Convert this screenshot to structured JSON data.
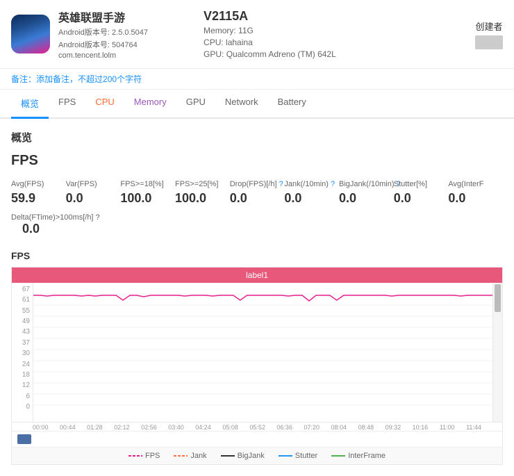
{
  "header": {
    "app_name": "英雄联盟手游",
    "android_version": "Android版本号: 2.5.0.5047",
    "android_build": "Android版本号: 504764",
    "package": "com.tencent.lolm",
    "device_model": "V2115A",
    "memory": "Memory: 11G",
    "cpu": "CPU: lahaina",
    "gpu": "GPU: Qualcomm Adreno (TM) 642L",
    "creator_label": "创建者"
  },
  "note": {
    "prefix": "备注：",
    "link_text": "添加备注，不超过200个字符"
  },
  "tabs": [
    {
      "id": "overview",
      "label": "概览",
      "active": true
    },
    {
      "id": "fps",
      "label": "FPS",
      "active": false
    },
    {
      "id": "cpu",
      "label": "CPU",
      "active": false,
      "color": "cpu"
    },
    {
      "id": "memory",
      "label": "Memory",
      "active": false,
      "color": "memory"
    },
    {
      "id": "gpu",
      "label": "GPU",
      "active": false
    },
    {
      "id": "network",
      "label": "Network",
      "active": false
    },
    {
      "id": "battery",
      "label": "Battery",
      "active": false
    }
  ],
  "page_title": "概览",
  "fps_section": {
    "title": "FPS",
    "metrics": [
      {
        "label": "Avg(FPS)",
        "value": "59.9"
      },
      {
        "label": "Var(FPS)",
        "value": "0.0"
      },
      {
        "label": "FPS>=18[%]",
        "value": "100.0"
      },
      {
        "label": "FPS>=25[%]",
        "value": "100.0"
      },
      {
        "label": "Drop(FPS)[/h]",
        "value": "0.0",
        "has_help": true
      },
      {
        "label": "Jank(/10min)",
        "value": "0.0",
        "has_help": true
      },
      {
        "label": "BigJank(/10min)",
        "value": "0.0",
        "has_help": true
      },
      {
        "label": "Stutter[%]",
        "value": "0.0"
      },
      {
        "label": "Avg(InterF",
        "value": "0.0"
      }
    ],
    "delta_label": "Delta(FTime)>100ms[/h]",
    "delta_has_help": true,
    "delta_value": "0.0"
  },
  "chart": {
    "title": "FPS",
    "label_bar": "label1",
    "y_labels": [
      "67",
      "61",
      "55",
      "49",
      "43",
      "37",
      "30",
      "24",
      "18",
      "12",
      "6",
      "0"
    ],
    "x_labels": [
      "00:00",
      "00:44",
      "01:28",
      "02:12",
      "02:56",
      "03:40",
      "04:24",
      "05:08",
      "05:52",
      "06:36",
      "07:20",
      "08:04",
      "08:48",
      "09:32",
      "10:16",
      "11:00",
      "11:44"
    ]
  },
  "legend": [
    {
      "label": "FPS",
      "color": "#e91e8c",
      "style": "dashed"
    },
    {
      "label": "Jank",
      "color": "#ff7043",
      "style": "dashed"
    },
    {
      "label": "BigJank",
      "color": "#333",
      "style": "solid"
    },
    {
      "label": "Stutter",
      "color": "#2196f3",
      "style": "solid"
    },
    {
      "label": "InterFrame",
      "color": "#4caf50",
      "style": "solid"
    }
  ],
  "colors": {
    "active_tab": "#1890ff",
    "cpu_tab": "#ff6b35",
    "memory_tab": "#9b59b6",
    "chart_line": "#e91e8c",
    "chart_bg_label": "#e8587a"
  }
}
